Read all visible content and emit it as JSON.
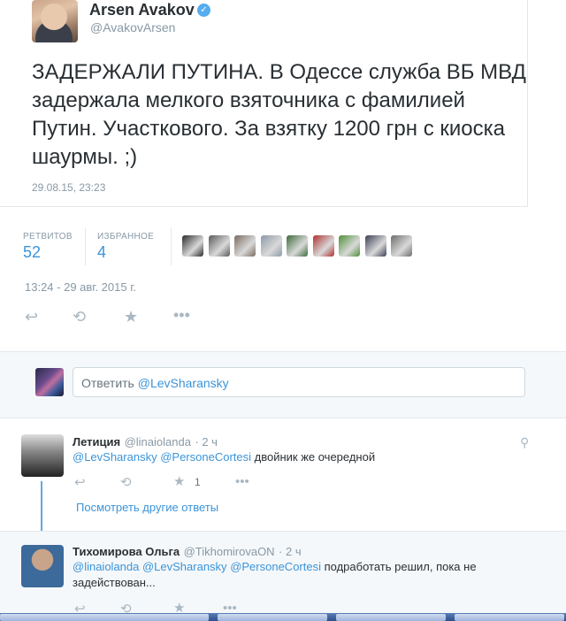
{
  "embedded_tweet": {
    "author_name": "Arsen Avakov",
    "verified_icon": "check-icon",
    "handle": "@AvakovArsen",
    "text": "ЗАДЕРЖАЛИ ПУТИНА. В Одессе служба ВБ МВД задержала мелкого взяточника с фамилией Путин. Участкового. За взятку 1200 грн с киоска шаурмы. ;)",
    "date": "29.08.15, 23:23"
  },
  "stats": {
    "retweets_label": "РЕТВИТОВ",
    "retweets_count": "52",
    "favorites_label": "ИЗБРАННОЕ",
    "favorites_count": "4",
    "favoriter_avatar_colors": [
      "#2b2b2b",
      "#5a5a5a",
      "#7a6a60",
      "#8c9aa8",
      "#3d6b3a",
      "#b03030",
      "#4f8f3a",
      "#3a3f55",
      "#6d6d6d"
    ]
  },
  "timestamp": "13:24 - 29 авг. 2015 г.",
  "actions": {
    "reply_icon": "reply-icon",
    "retweet_icon": "retweet-icon",
    "favorite_icon": "star-icon",
    "more_icon": "more-icon"
  },
  "reply_box": {
    "prefix": "Ответить ",
    "mention": "@LevSharansky"
  },
  "replies": [
    {
      "name": "Летиция",
      "handle": "@linaiolanda",
      "time": "· 2 ч",
      "mentions": [
        "@LevSharansky",
        "@PersoneCortesi"
      ],
      "text": " двойник же очередной",
      "favorite_count": "1",
      "more_replies": "Посмотреть другие ответы",
      "avatar_color": "#3a3a3a"
    },
    {
      "name": "Тихомирова Ольга",
      "handle": "@TikhomirovaON",
      "time": "· 2 ч",
      "mentions": [
        "@linaiolanda",
        "@LevSharansky",
        "@PersoneCortesi"
      ],
      "text_line1": " подработать решил, пока не",
      "text_line2": "задействован...",
      "avatar_color": "#3c6a9a"
    }
  ]
}
